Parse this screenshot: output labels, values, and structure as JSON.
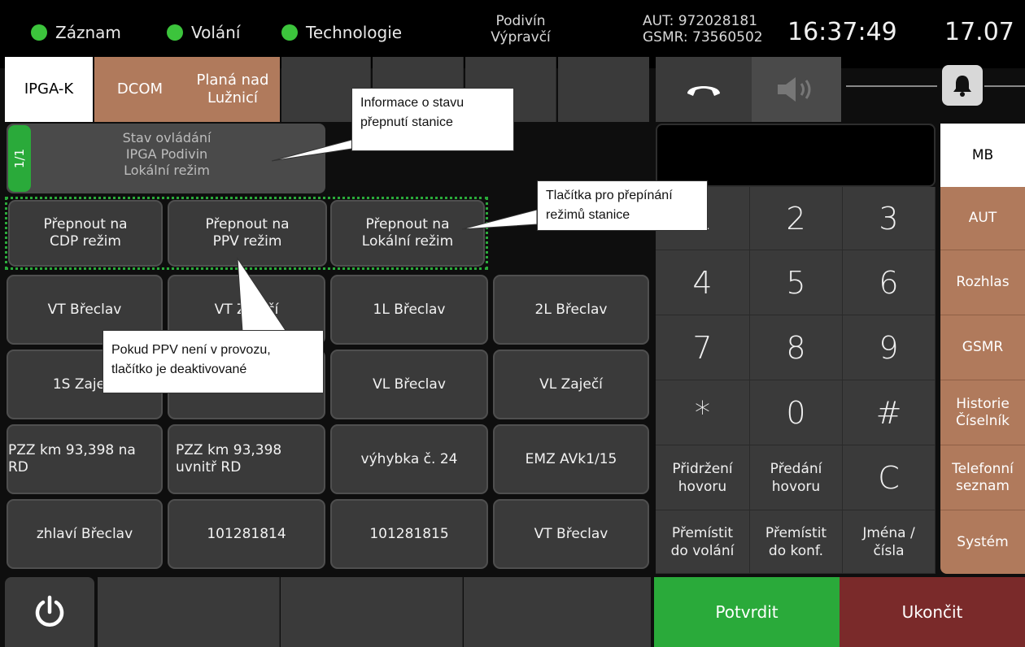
{
  "status": {
    "record": "Záznam",
    "call": "Volání",
    "tech": "Technologie",
    "station": "Podivín",
    "role": "Výpravčí",
    "aut": "AUT: 972028181",
    "gsmr": "GSMR: 73560502",
    "time": "16:37:49",
    "date": "17.07",
    "indicator_color": "#3cc43c"
  },
  "tabs": [
    {
      "label": "IPGA-K"
    },
    {
      "label": "DCOM"
    },
    {
      "label": "Planá nad\nLužnicí"
    }
  ],
  "state_panel": {
    "page": "1/1",
    "line1": "Stav ovládání",
    "line2": "IPGA Podivin",
    "line3": "Lokální režim"
  },
  "mode_buttons": [
    "Přepnout na\nCDP režim",
    "Přepnout na\nPPV režim",
    "Přepnout na\nLokální režim"
  ],
  "grid": [
    [
      "VT Břeclav",
      "VT Zaječí",
      "1L Břeclav",
      "2L Břeclav"
    ],
    [
      "1S Zaječí",
      "",
      "VL Břeclav",
      "VL Zaječí"
    ],
    [
      "PZZ km 93,398 na\nRD",
      "PZZ km 93,398\nuvnitř RD",
      "výhybka č. 24",
      "EMZ AVk1/15"
    ],
    [
      "zhlaví Břeclav",
      "101281814",
      "101281815",
      "VT Břeclav"
    ]
  ],
  "keypad": {
    "keys": [
      "1",
      "2",
      "3",
      "4",
      "5",
      "6",
      "7",
      "8",
      "9",
      "*",
      "0",
      "#"
    ],
    "hold": "Přidržení\nhovoru",
    "transfer": "Předání\nhovoru",
    "clear": "C",
    "move_call": "Přemístit\ndo volání",
    "move_conf": "Přemístit\ndo konf.",
    "names": "Jména /\nčísla"
  },
  "side_menu": [
    {
      "label": "MB",
      "active": true
    },
    {
      "label": "AUT"
    },
    {
      "label": "Rozhlas"
    },
    {
      "label": "GSMR"
    },
    {
      "label": "Historie\nČíselník"
    },
    {
      "label": "Telefonní\nseznam"
    },
    {
      "label": "Systém"
    }
  ],
  "bottom": {
    "confirm": "Potvrdit",
    "end": "Ukončit"
  },
  "callouts": {
    "state_info": "Informace o stavu\npřepnutí stanice",
    "mode_info": "Tlačítka pro přepínání\nrežimů stanice",
    "ppv_info": "Pokud PPV není v provozu,\ntlačítko je deaktivované"
  },
  "colors": {
    "accent_tab": "#b07a5c",
    "confirm": "#2aaa3a",
    "end": "#7a2a2a",
    "page_badge": "#2aaa3a"
  }
}
